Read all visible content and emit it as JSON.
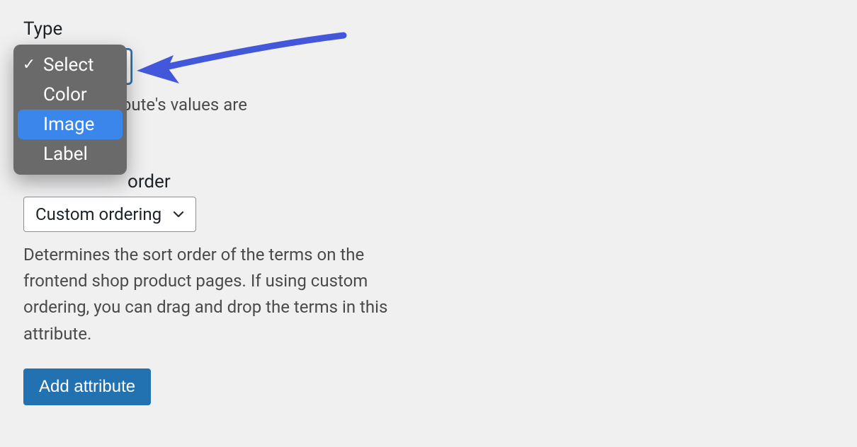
{
  "type_field": {
    "label": "Type",
    "help_visible": "how this attribute's values are",
    "options": [
      {
        "label": "Select",
        "checked": true,
        "highlight": false
      },
      {
        "label": "Color",
        "checked": false,
        "highlight": false
      },
      {
        "label": "Image",
        "checked": false,
        "highlight": true
      },
      {
        "label": "Label",
        "checked": false,
        "highlight": false
      }
    ]
  },
  "sort_field": {
    "label_partial": "order",
    "select_value": "Custom ordering",
    "help": "Determines the sort order of the terms on the frontend shop product pages. If using custom ordering, you can drag and drop the terms in this attribute."
  },
  "buttons": {
    "add_attribute": "Add attribute"
  },
  "annotation": {
    "arrow_color": "#4257d9"
  }
}
